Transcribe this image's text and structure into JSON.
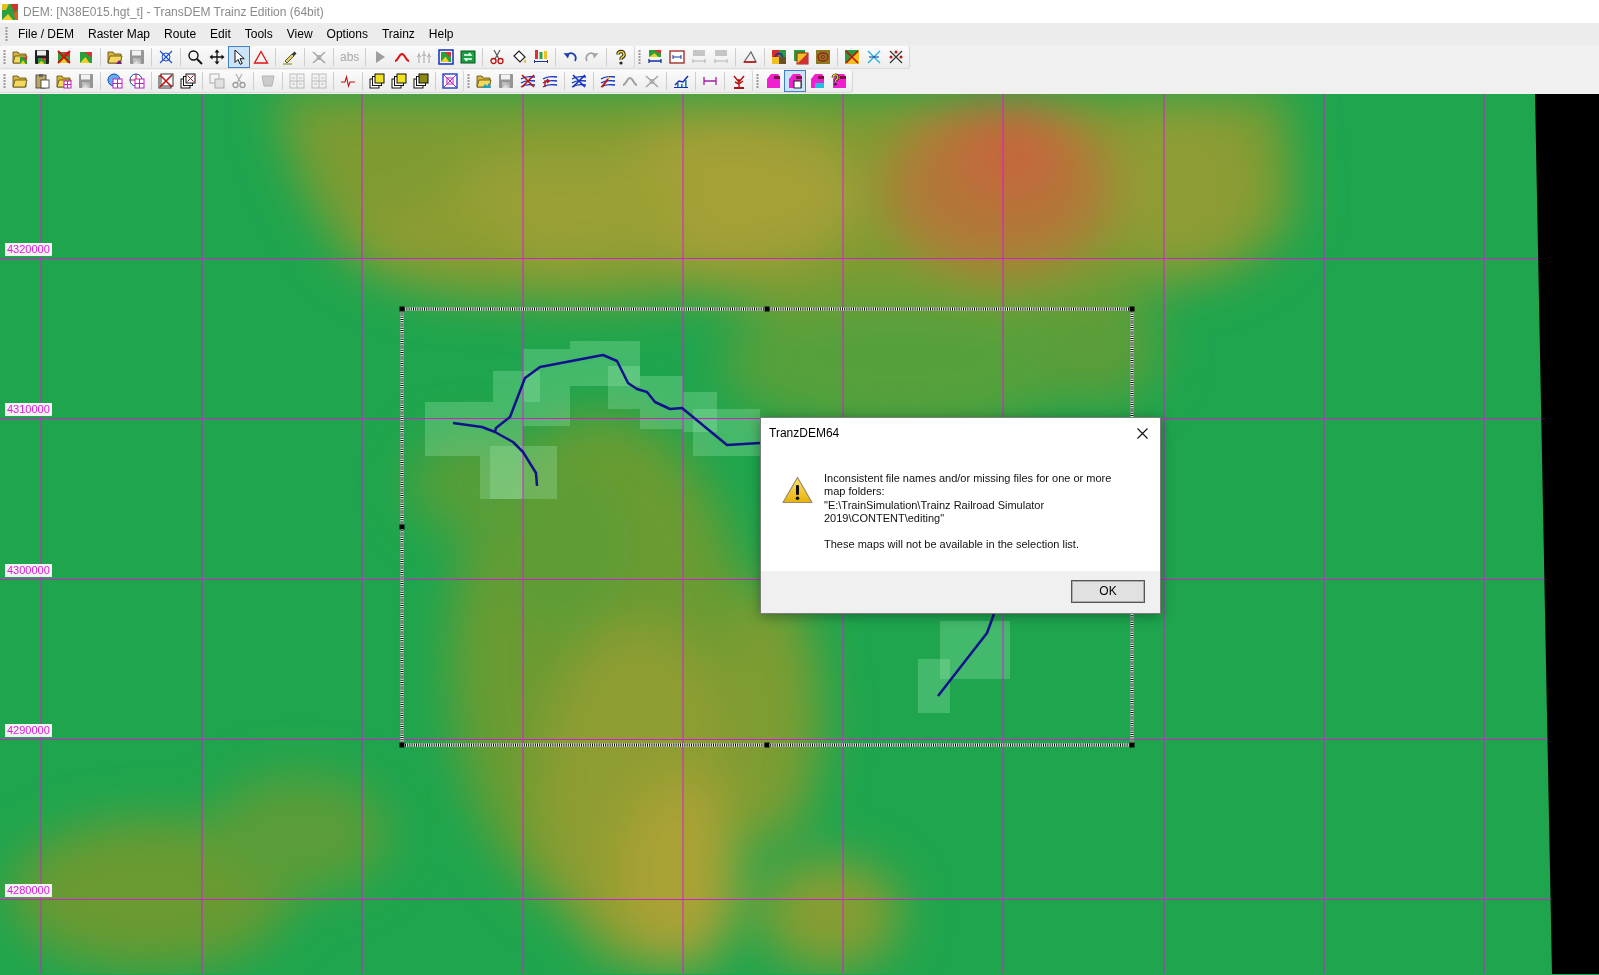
{
  "window": {
    "title": "DEM: [N38E015.hgt_t] - TransDEM Trainz Edition (64bit)"
  },
  "menu": [
    "File / DEM",
    "Raster Map",
    "Route",
    "Edit",
    "Tools",
    "View",
    "Options",
    "Trainz",
    "Help"
  ],
  "toolbar_rows": [
    [
      {
        "groups": [
          [
            {
              "disabled": false,
              "selected": false
            },
            {
              "disabled": false,
              "selected": false
            },
            {
              "disabled": false,
              "selected": false
            },
            {
              "disabled": false,
              "selected": false
            }
          ],
          [
            {
              "disabled": false,
              "selected": false
            },
            {
              "disabled": true,
              "selected": false
            }
          ],
          [
            {
              "disabled": false,
              "selected": false
            }
          ],
          [
            {
              "disabled": false,
              "selected": false
            },
            {
              "disabled": false,
              "selected": false
            },
            {
              "disabled": false,
              "selected": true
            },
            {
              "disabled": false,
              "selected": false
            }
          ],
          [
            {
              "disabled": false,
              "selected": false
            }
          ],
          [
            {
              "disabled": true,
              "selected": false
            }
          ],
          [
            {
              "label": "abs",
              "disabled": true,
              "selected": false
            }
          ],
          [
            {
              "disabled": true,
              "selected": false
            },
            {
              "disabled": false,
              "selected": false
            },
            {
              "disabled": true,
              "selected": false
            },
            {
              "disabled": false,
              "selected": false
            },
            {
              "disabled": false,
              "selected": false
            }
          ],
          [
            {
              "disabled": false,
              "selected": false
            },
            {
              "disabled": false,
              "selected": false
            },
            {
              "disabled": false,
              "selected": false
            }
          ],
          [
            {
              "disabled": false,
              "selected": false
            },
            {
              "disabled": true,
              "selected": false
            }
          ],
          [
            {
              "disabled": false,
              "selected": false
            }
          ]
        ]
      },
      {
        "groups": [
          [
            {
              "disabled": false,
              "selected": false
            },
            {
              "disabled": false,
              "selected": false
            },
            {
              "disabled": true,
              "selected": false
            },
            {
              "disabled": true,
              "selected": false
            }
          ],
          [
            {
              "disabled": false,
              "selected": false
            }
          ],
          [
            {
              "disabled": false,
              "selected": false
            },
            {
              "disabled": false,
              "selected": false
            },
            {
              "disabled": false,
              "selected": false
            }
          ],
          [
            {
              "disabled": false,
              "selected": false
            },
            {
              "disabled": false,
              "selected": false
            },
            {
              "disabled": false,
              "selected": false
            }
          ]
        ]
      }
    ],
    [
      {
        "groups": [
          [
            {
              "disabled": false,
              "selected": false
            },
            {
              "disabled": false,
              "selected": false
            },
            {
              "disabled": false,
              "selected": false
            },
            {
              "disabled": true,
              "selected": false
            }
          ],
          [
            {
              "disabled": false,
              "selected": false
            },
            {
              "disabled": false,
              "selected": false
            }
          ],
          [
            {
              "disabled": false,
              "selected": false
            },
            {
              "disabled": false,
              "selected": false
            }
          ],
          [
            {
              "disabled": true,
              "selected": false
            },
            {
              "disabled": true,
              "selected": false
            }
          ],
          [
            {
              "disabled": true,
              "selected": false
            }
          ],
          [
            {
              "disabled": true,
              "selected": false
            },
            {
              "disabled": true,
              "selected": false
            }
          ],
          [
            {
              "disabled": false,
              "selected": false
            }
          ],
          [
            {
              "disabled": false,
              "selected": false
            },
            {
              "disabled": false,
              "selected": false
            },
            {
              "disabled": false,
              "selected": false
            }
          ],
          [
            {
              "disabled": false,
              "selected": false
            }
          ]
        ]
      },
      {
        "groups": [
          [
            {
              "disabled": false,
              "selected": false
            },
            {
              "disabled": true,
              "selected": false
            },
            {
              "disabled": false,
              "selected": false
            },
            {
              "disabled": false,
              "selected": false
            }
          ],
          [
            {
              "disabled": false,
              "selected": false
            }
          ],
          [
            {
              "disabled": false,
              "selected": false
            },
            {
              "disabled": true,
              "selected": false
            },
            {
              "disabled": true,
              "selected": false
            }
          ],
          [
            {
              "disabled": false,
              "selected": false
            }
          ],
          [
            {
              "disabled": false,
              "selected": false
            }
          ],
          [
            {
              "disabled": false,
              "selected": false
            }
          ]
        ]
      },
      {
        "groups": [
          [
            {
              "disabled": false,
              "selected": false
            },
            {
              "disabled": false,
              "selected": true
            },
            {
              "disabled": false,
              "selected": false
            },
            {
              "disabled": false,
              "selected": false
            }
          ]
        ]
      }
    ]
  ],
  "map": {
    "grid_labels": [
      "4320000",
      "4310000",
      "4300000",
      "4290000",
      "4280000"
    ]
  },
  "dialog": {
    "title": "TranzDEM64",
    "message": [
      "Inconsistent file names and/or missing files for one or more map folders:\n\"E:\\TrainSimulation\\Trainz Railroad Simulator 2019\\CONTENT\\editing\"",
      "These maps will not be available in the selection list."
    ],
    "buttons": [
      {
        "label": "OK"
      }
    ]
  }
}
